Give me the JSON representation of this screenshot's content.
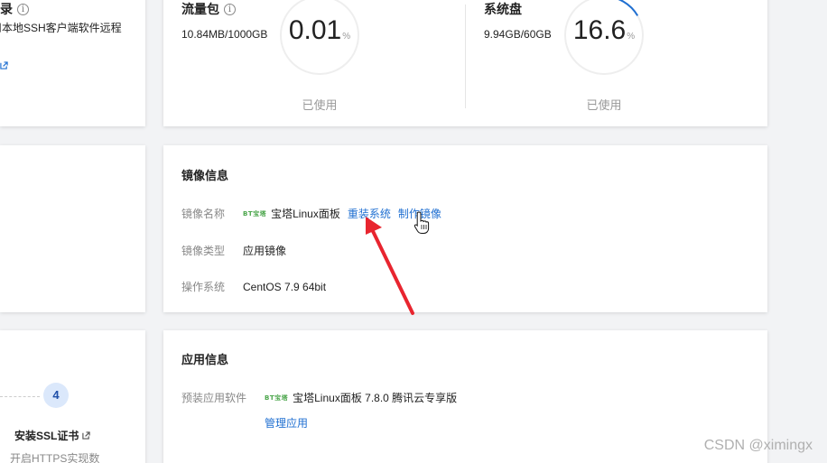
{
  "login_card": {
    "title": "登录",
    "description": "用本地SSH客户端软件远程"
  },
  "usage": {
    "traffic": {
      "title": "流量包",
      "amount": "10.84MB/1000GB",
      "percent": "0.01",
      "percent_value": 0.01,
      "unit": "%",
      "caption": "已使用"
    },
    "disk": {
      "title": "系统盘",
      "amount": "9.94GB/60GB",
      "percent": "16.6",
      "percent_value": 16.6,
      "unit": "%",
      "caption": "已使用"
    }
  },
  "image_info": {
    "title": "镜像信息",
    "rows": [
      {
        "label": "镜像名称",
        "value": "宝塔Linux面板",
        "logo": "BT宝塔"
      },
      {
        "label": "镜像类型",
        "value": "应用镜像"
      },
      {
        "label": "操作系统",
        "value": "CentOS 7.9 64bit"
      }
    ],
    "actions": {
      "reinstall": "重装系统",
      "make_image": "制作镜像"
    }
  },
  "app_info": {
    "title": "应用信息",
    "label": "预装应用软件",
    "logo": "BT宝塔",
    "value": "宝塔Linux面板 7.8.0 腾讯云专享版",
    "manage_link": "管理应用"
  },
  "ssl_step": {
    "number": "4",
    "title": "安装SSL证书",
    "description": "开启HTTPS实现数"
  },
  "watermark": "CSDN @ximingx",
  "colors": {
    "link": "#1f6fd1",
    "ring_progress": "#1f6fd1",
    "ring_track": "#eeeeee",
    "arrow": "#e8252f"
  },
  "icons": [
    "info-icon",
    "external-link-icon",
    "bt-logo",
    "pointer-cursor-icon"
  ]
}
